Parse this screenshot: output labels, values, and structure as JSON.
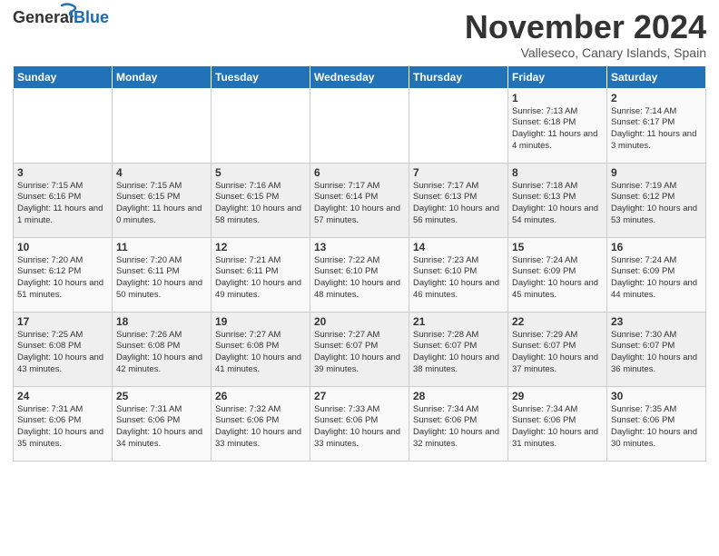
{
  "logo": {
    "general": "General",
    "blue": "Blue"
  },
  "title": "November 2024",
  "subtitle": "Valleseco, Canary Islands, Spain",
  "headers": [
    "Sunday",
    "Monday",
    "Tuesday",
    "Wednesday",
    "Thursday",
    "Friday",
    "Saturday"
  ],
  "weeks": [
    [
      {
        "day": "",
        "info": ""
      },
      {
        "day": "",
        "info": ""
      },
      {
        "day": "",
        "info": ""
      },
      {
        "day": "",
        "info": ""
      },
      {
        "day": "",
        "info": ""
      },
      {
        "day": "1",
        "info": "Sunrise: 7:13 AM\nSunset: 6:18 PM\nDaylight: 11 hours and 4 minutes."
      },
      {
        "day": "2",
        "info": "Sunrise: 7:14 AM\nSunset: 6:17 PM\nDaylight: 11 hours and 3 minutes."
      }
    ],
    [
      {
        "day": "3",
        "info": "Sunrise: 7:15 AM\nSunset: 6:16 PM\nDaylight: 11 hours and 1 minute."
      },
      {
        "day": "4",
        "info": "Sunrise: 7:15 AM\nSunset: 6:15 PM\nDaylight: 11 hours and 0 minutes."
      },
      {
        "day": "5",
        "info": "Sunrise: 7:16 AM\nSunset: 6:15 PM\nDaylight: 10 hours and 58 minutes."
      },
      {
        "day": "6",
        "info": "Sunrise: 7:17 AM\nSunset: 6:14 PM\nDaylight: 10 hours and 57 minutes."
      },
      {
        "day": "7",
        "info": "Sunrise: 7:17 AM\nSunset: 6:13 PM\nDaylight: 10 hours and 56 minutes."
      },
      {
        "day": "8",
        "info": "Sunrise: 7:18 AM\nSunset: 6:13 PM\nDaylight: 10 hours and 54 minutes."
      },
      {
        "day": "9",
        "info": "Sunrise: 7:19 AM\nSunset: 6:12 PM\nDaylight: 10 hours and 53 minutes."
      }
    ],
    [
      {
        "day": "10",
        "info": "Sunrise: 7:20 AM\nSunset: 6:12 PM\nDaylight: 10 hours and 51 minutes."
      },
      {
        "day": "11",
        "info": "Sunrise: 7:20 AM\nSunset: 6:11 PM\nDaylight: 10 hours and 50 minutes."
      },
      {
        "day": "12",
        "info": "Sunrise: 7:21 AM\nSunset: 6:11 PM\nDaylight: 10 hours and 49 minutes."
      },
      {
        "day": "13",
        "info": "Sunrise: 7:22 AM\nSunset: 6:10 PM\nDaylight: 10 hours and 48 minutes."
      },
      {
        "day": "14",
        "info": "Sunrise: 7:23 AM\nSunset: 6:10 PM\nDaylight: 10 hours and 46 minutes."
      },
      {
        "day": "15",
        "info": "Sunrise: 7:24 AM\nSunset: 6:09 PM\nDaylight: 10 hours and 45 minutes."
      },
      {
        "day": "16",
        "info": "Sunrise: 7:24 AM\nSunset: 6:09 PM\nDaylight: 10 hours and 44 minutes."
      }
    ],
    [
      {
        "day": "17",
        "info": "Sunrise: 7:25 AM\nSunset: 6:08 PM\nDaylight: 10 hours and 43 minutes."
      },
      {
        "day": "18",
        "info": "Sunrise: 7:26 AM\nSunset: 6:08 PM\nDaylight: 10 hours and 42 minutes."
      },
      {
        "day": "19",
        "info": "Sunrise: 7:27 AM\nSunset: 6:08 PM\nDaylight: 10 hours and 41 minutes."
      },
      {
        "day": "20",
        "info": "Sunrise: 7:27 AM\nSunset: 6:07 PM\nDaylight: 10 hours and 39 minutes."
      },
      {
        "day": "21",
        "info": "Sunrise: 7:28 AM\nSunset: 6:07 PM\nDaylight: 10 hours and 38 minutes."
      },
      {
        "day": "22",
        "info": "Sunrise: 7:29 AM\nSunset: 6:07 PM\nDaylight: 10 hours and 37 minutes."
      },
      {
        "day": "23",
        "info": "Sunrise: 7:30 AM\nSunset: 6:07 PM\nDaylight: 10 hours and 36 minutes."
      }
    ],
    [
      {
        "day": "24",
        "info": "Sunrise: 7:31 AM\nSunset: 6:06 PM\nDaylight: 10 hours and 35 minutes."
      },
      {
        "day": "25",
        "info": "Sunrise: 7:31 AM\nSunset: 6:06 PM\nDaylight: 10 hours and 34 minutes."
      },
      {
        "day": "26",
        "info": "Sunrise: 7:32 AM\nSunset: 6:06 PM\nDaylight: 10 hours and 33 minutes."
      },
      {
        "day": "27",
        "info": "Sunrise: 7:33 AM\nSunset: 6:06 PM\nDaylight: 10 hours and 33 minutes."
      },
      {
        "day": "28",
        "info": "Sunrise: 7:34 AM\nSunset: 6:06 PM\nDaylight: 10 hours and 32 minutes."
      },
      {
        "day": "29",
        "info": "Sunrise: 7:34 AM\nSunset: 6:06 PM\nDaylight: 10 hours and 31 minutes."
      },
      {
        "day": "30",
        "info": "Sunrise: 7:35 AM\nSunset: 6:06 PM\nDaylight: 10 hours and 30 minutes."
      }
    ]
  ]
}
